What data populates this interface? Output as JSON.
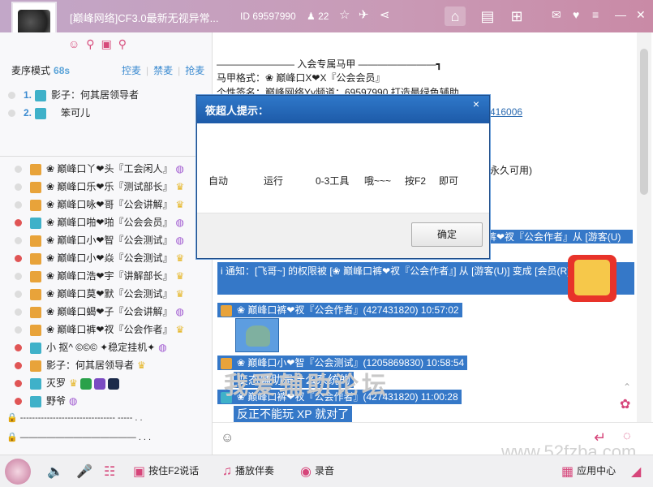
{
  "titlebar": {
    "title": "[巅峰网络]CF3.0最新无视异常...",
    "room_id": "ID 69597990",
    "user_count": "22"
  },
  "left": {
    "mode_label": "麦序模式",
    "mode_time": "68s",
    "tabs": [
      "控麦",
      "禁麦",
      "抢麦"
    ],
    "queue": [
      {
        "num": "1.",
        "name": "影子：何其居领导者"
      },
      {
        "num": "2.",
        "name": "笨可儿"
      }
    ],
    "users": [
      {
        "name": "❀ 巅峰口丫❤头『工会闲人』"
      },
      {
        "name": "❀ 巅峰口乐❤乐『测试部长』"
      },
      {
        "name": "❀ 巅峰口咏❤哥『公会讲解』"
      },
      {
        "name": "❀ 巅峰口啪❤啪『公会会员』"
      },
      {
        "name": "❀ 巅峰口小❤智『公会测试』"
      },
      {
        "name": "❀ 巅峰口小❤焱『公会测试』"
      },
      {
        "name": "❀ 巅峰口浩❤宇『讲解部长』"
      },
      {
        "name": "❀ 巅峰口莫❤默『公会测试』"
      },
      {
        "name": "❀ 巅峰口蝎❤子『公会讲解』"
      },
      {
        "name": "❀ 巅峰口裤❤衩『公会作者』"
      },
      {
        "name": "小 抠^ ©©©   ✦稳定挂机✦"
      },
      {
        "name": "影子：何其居领导者"
      },
      {
        "name": "灭罗"
      },
      {
        "name": "野爷"
      }
    ],
    "bottom_rows": [
      "-------------------------------- ----- . .",
      "————————————— . . ."
    ]
  },
  "chat": {
    "lines": [
      "———————— 入会专属马甲 ————————┓",
      "马甲格式：❀ 巅峰口X❤X『公会会员』",
      "个性签名：巅峰网络Yy频道：69597990 打造最绿色辅助",
      "416006",
      "永久可用)",
      "裤❤衩『公会作者』从 [游客(U)"
    ],
    "notice": "i  通知：[飞哥~] 的权限被 [❀ 巅峰口裤❤衩『公会作者』] 从 [游客(U)] 变成 [会员(R)] 10:56:46)",
    "messages": [
      {
        "header": "❀ 巅峰口裤❤衩『公会作者』(427431820) 10:57:02",
        "body": ""
      },
      {
        "header": "❀ 巅峰口小❤智『公会测试』(1205869830) 10:58:54",
        "body": "变态辅助是什么系统的"
      },
      {
        "header": "❀ 巅峰口裤❤衩『公会作者』(427431820) 11:00:28",
        "body": "反正不能玩  XP  就对了"
      }
    ],
    "watermark": "我爱辅助论坛",
    "watermark_url": "www.52fzba.com"
  },
  "dialog": {
    "title": "筱超人提示：",
    "message_parts": [
      "自动",
      "运行",
      "0-3工具",
      "哦~~~",
      "按F2",
      "即可"
    ],
    "ok_label": "确定",
    "close": "×"
  },
  "bottom_bar": {
    "f2_label": "按住F2说话",
    "music_label": "播放伴奏",
    "record_label": "录音",
    "app_center": "应用中心"
  }
}
